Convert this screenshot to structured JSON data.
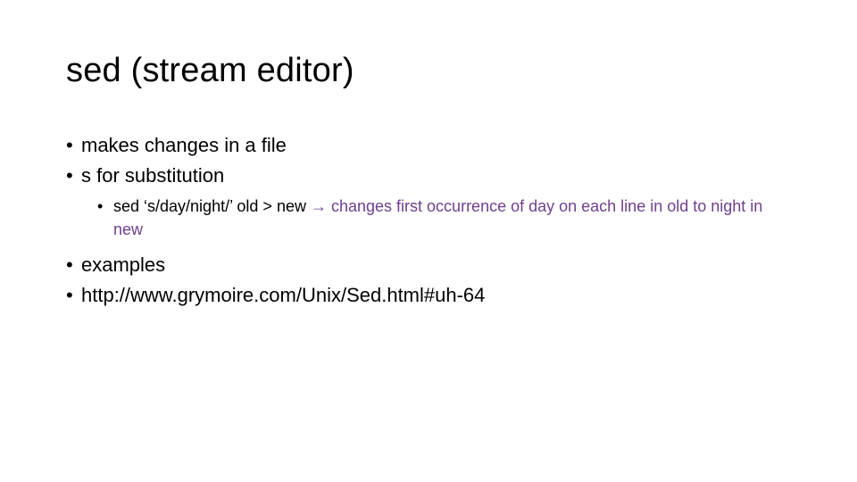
{
  "slide": {
    "title": "sed (stream editor)",
    "bullets": [
      {
        "marker": "•",
        "text": "makes changes in a file"
      },
      {
        "marker": "•",
        "text": "s for substitution"
      }
    ],
    "sub_bullet": {
      "marker": "•",
      "command": "sed ‘s/day/night/’ old > new",
      "arrow": "→",
      "explanation": "changes first occurrence of day on each line in old to night in new"
    },
    "bullets_after": [
      {
        "marker": "•",
        "text": "examples"
      },
      {
        "marker": "•",
        "text": "http://www.grymoire.com/Unix/Sed.html#uh-64"
      }
    ],
    "accent_color": "#6f3f8e"
  }
}
